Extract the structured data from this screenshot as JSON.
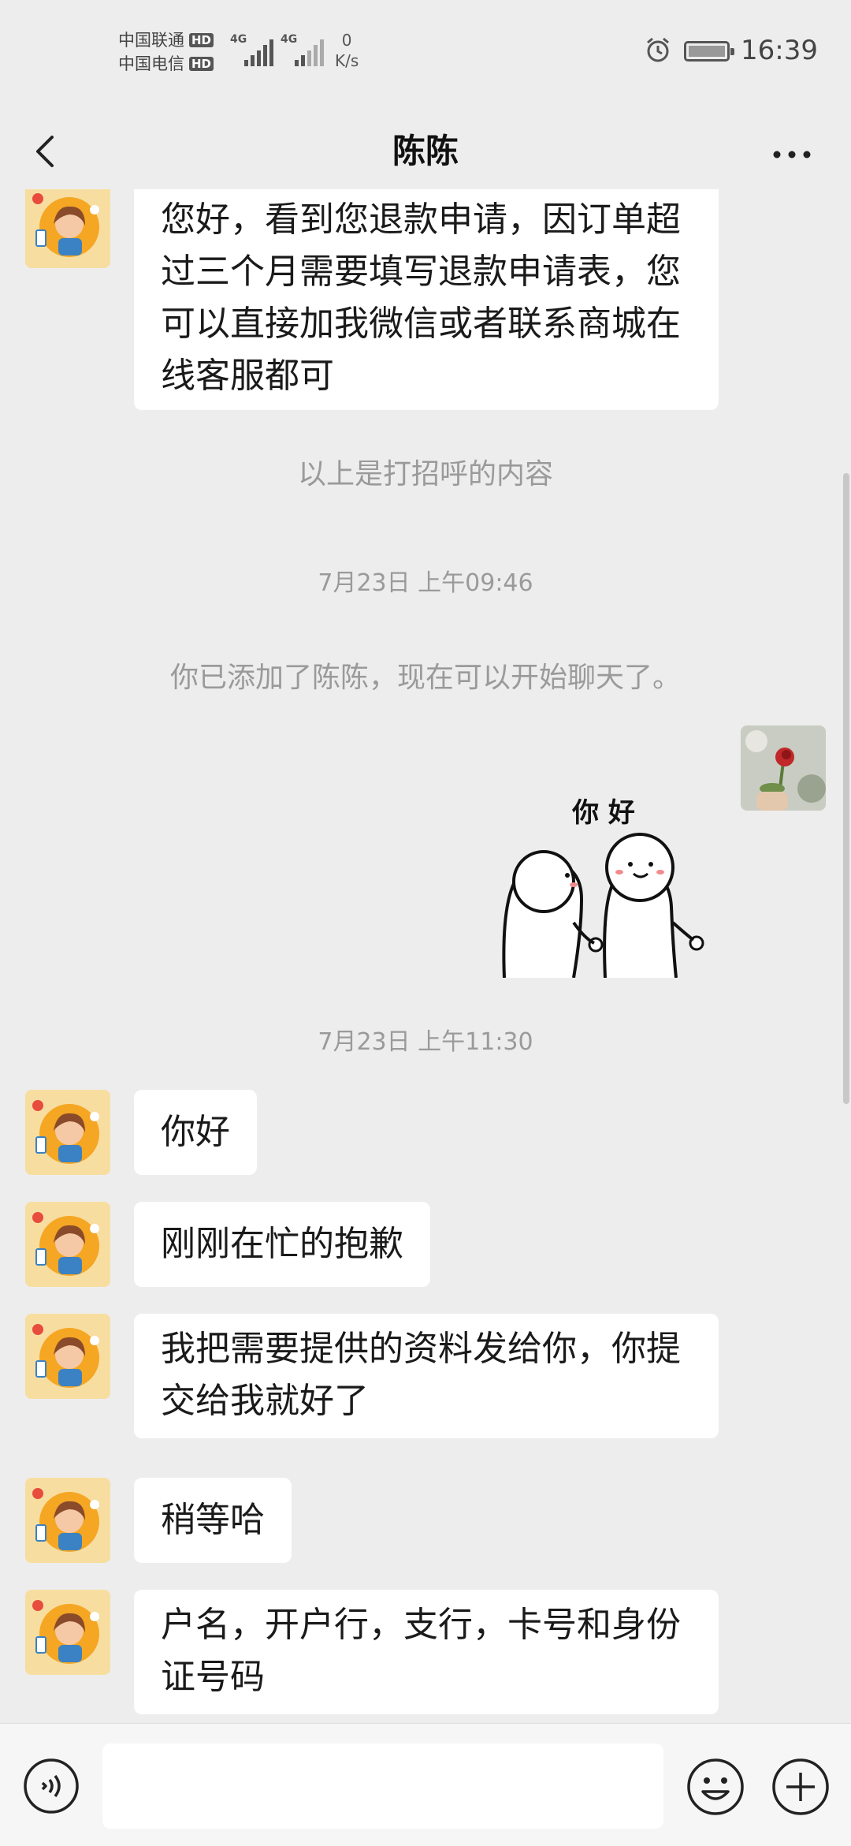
{
  "status_bar": {
    "carrier1": "中国联通",
    "carrier2": "中国电信",
    "hd_badge": "HD",
    "network_type": "4G",
    "net_speed_value": "0",
    "net_speed_unit": "K/s",
    "time": "16:39"
  },
  "header": {
    "title": "陈陈"
  },
  "messages": {
    "m1": "您好，看到您退款申请，因订单超过三个月需要填写退款申请表，您可以直接加我微信或者联系商城在线客服都可",
    "m2": "你好",
    "m3": "刚刚在忙的抱歉",
    "m4": "我把需要提供的资料发给你，你提交给我就好了",
    "m5": "稍等哈",
    "m6": "户名，开户行，支行，卡号和身份证号码"
  },
  "system": {
    "greeting_note": "以上是打招呼的内容",
    "time1": "7月23日 上午09:46",
    "added_note": "你已添加了陈陈，现在可以开始聊天了。",
    "time2": "7月23日 上午11:30"
  },
  "sticker": {
    "text": "你 好"
  },
  "colors": {
    "background": "#ededed",
    "bubble": "#ffffff",
    "system_text": "#9a9a9a"
  },
  "icons": [
    "back-icon",
    "more-icon",
    "voice-icon",
    "emoji-icon",
    "plus-icon",
    "alarm-icon",
    "battery-icon"
  ]
}
